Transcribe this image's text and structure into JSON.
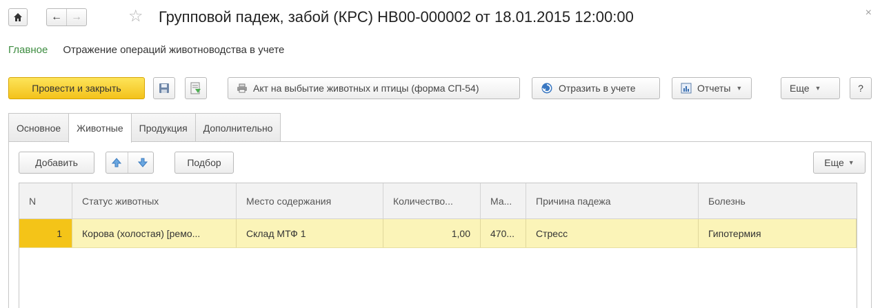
{
  "window": {
    "title": "Групповой падеж, забой (КРС) НВ00-000002 от 18.01.2015 12:00:00",
    "close_glyph": "×"
  },
  "sections": {
    "main": "Главное",
    "link": "Отражение операций животноводства в учете"
  },
  "toolbar": {
    "post_and_close": "Провести и закрыть",
    "act_label": "Акт на выбытие животных и птицы (форма СП-54)",
    "reflect_label": "Отразить в учете",
    "reports_label": "Отчеты",
    "more_label": "Еще",
    "help_label": "?"
  },
  "tabs": [
    {
      "label": "Основное",
      "active": false
    },
    {
      "label": "Животные",
      "active": true
    },
    {
      "label": "Продукция",
      "active": false
    },
    {
      "label": "Дополнительно",
      "active": false
    }
  ],
  "panel": {
    "add_label": "Добавить",
    "pick_label": "Подбор",
    "more_label": "Еще"
  },
  "table": {
    "columns": [
      "N",
      "Статус животных",
      "Место содержания",
      "Количество...",
      "Ма...",
      "Причина падежа",
      "Болезнь"
    ],
    "rows": [
      {
        "n": "1",
        "status": "Корова (холостая) [ремо...",
        "place": "Склад МТФ 1",
        "qty": "1,00",
        "mass": "470...",
        "reason": "Стресс",
        "disease": "Гипотермия"
      }
    ]
  },
  "colors": {
    "primary_button": "#f3c21b",
    "section_active": "#3d8c40",
    "selected_row": "#fbf4b8",
    "selected_cell": "#f4c418"
  }
}
